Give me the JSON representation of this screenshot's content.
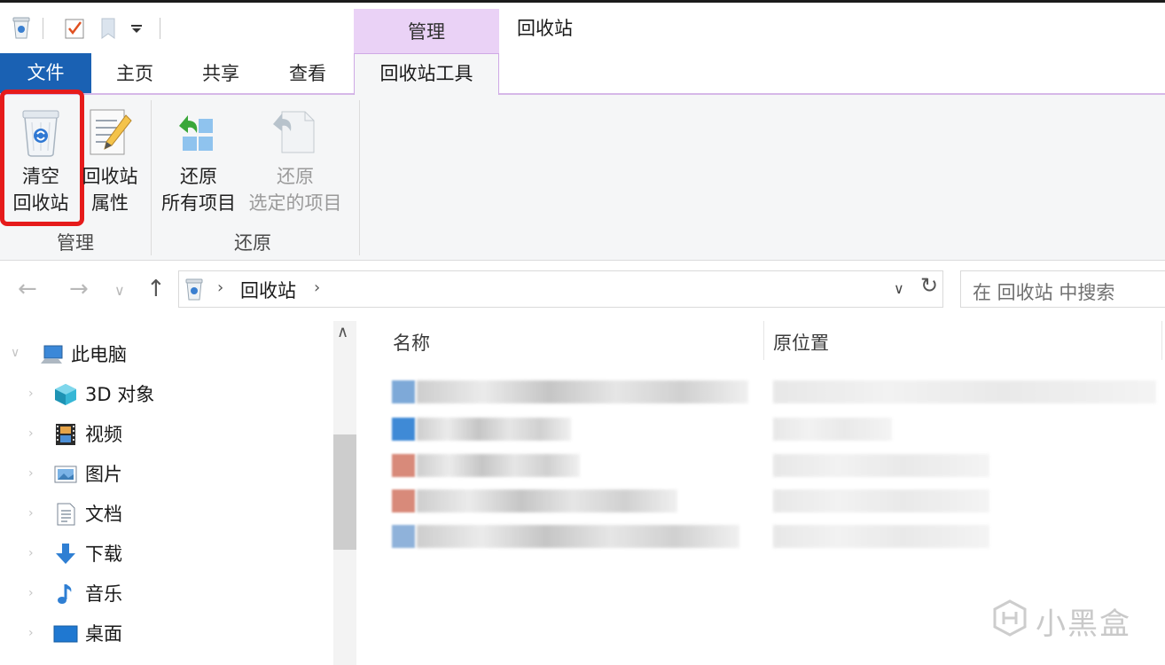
{
  "title_bar": {
    "context_tab": "管理",
    "window_title": "回收站"
  },
  "tabs": {
    "file": "文件",
    "home": "主页",
    "share": "共享",
    "view": "查看",
    "recycle_tools": "回收站工具"
  },
  "ribbon": {
    "empty_bin": {
      "line1": "清空",
      "line2": "回收站"
    },
    "bin_properties": {
      "line1": "回收站",
      "line2": "属性"
    },
    "restore_all": {
      "line1": "还原",
      "line2": "所有项目"
    },
    "restore_selected": {
      "line1": "还原",
      "line2": "选定的项目"
    },
    "group_manage": "管理",
    "group_restore": "还原"
  },
  "address": {
    "breadcrumb": "回收站",
    "search_placeholder": "在 回收站 中搜索"
  },
  "nav_pane": {
    "items": [
      {
        "label": "此电脑",
        "icon": "computer-icon"
      },
      {
        "label": "3D 对象",
        "icon": "cube-3d-icon"
      },
      {
        "label": "视频",
        "icon": "video-icon"
      },
      {
        "label": "图片",
        "icon": "picture-icon"
      },
      {
        "label": "文档",
        "icon": "document-icon"
      },
      {
        "label": "下载",
        "icon": "download-icon"
      },
      {
        "label": "音乐",
        "icon": "music-icon"
      },
      {
        "label": "桌面",
        "icon": "desktop-icon"
      }
    ]
  },
  "file_list": {
    "columns": {
      "name": "名称",
      "original_location": "原位置"
    },
    "row_count": 5
  },
  "watermark": "小黑盒",
  "colors": {
    "file_tab": "#1a61b3",
    "context_tab": "#ead2f6",
    "highlight": "#e61b1b",
    "ribbon_bg": "#f5f6f7"
  }
}
